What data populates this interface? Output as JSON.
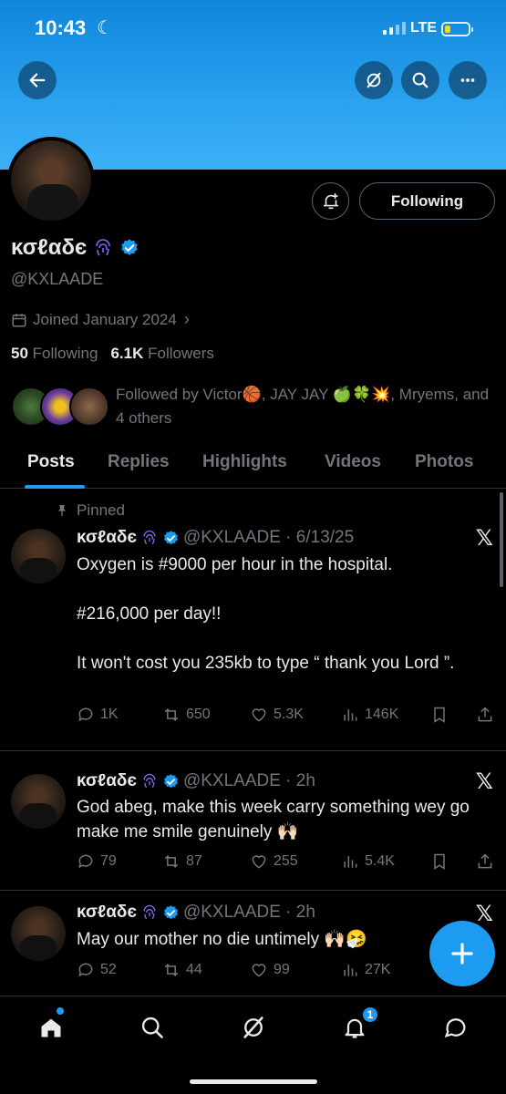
{
  "status_bar": {
    "time": "10:43",
    "network": "LTE",
    "colors": {
      "battery": "#ffd60a"
    }
  },
  "header": {
    "back_icon": "arrow-left-icon",
    "grok_icon": "grok-icon",
    "search_icon": "search-icon",
    "more_icon": "more-icon"
  },
  "profile": {
    "name": "κσℓαδє",
    "handle": "@KXLAADE",
    "joined": "Joined January 2024",
    "following_count": "50",
    "following_label": "Following",
    "followers_count": "6.1K",
    "followers_label": "Followers",
    "follow_button": "Following",
    "followed_by": "Followed by Victor🏀, JAY JAY 🍏🍀💥, Mryems, and 4 others"
  },
  "tabs": [
    {
      "label": "Posts",
      "active": true
    },
    {
      "label": "Replies"
    },
    {
      "label": "Highlights"
    },
    {
      "label": "Videos"
    },
    {
      "label": "Photos"
    }
  ],
  "tweets": [
    {
      "pinned_label": "Pinned",
      "name": "κσℓαδє",
      "meta": "@KXLAADE · 6/13/25",
      "text": "Oxygen is #9000 per hour in the hospital.\n\n#216,000 per day!!\n\nIt won't cost you 235kb to type “ thank you Lord ”.",
      "replies": "1K",
      "reposts": "650",
      "likes": "5.3K",
      "views": "146K"
    },
    {
      "name": "κσℓαδє",
      "meta": "@KXLAADE · 2h",
      "text": "God abeg, make this week carry something wey go make me smile genuinely 🙌🏻",
      "replies": "79",
      "reposts": "87",
      "likes": "255",
      "views": "5.4K"
    },
    {
      "name": "κσℓαδє",
      "meta": "@KXLAADE · 2h",
      "text": "May our mother no die untimely 🙌🏻🤧",
      "replies": "52",
      "reposts": "44",
      "likes": "99",
      "views": "27K"
    }
  ],
  "bottom_nav": {
    "notifications_badge": "1"
  },
  "colors": {
    "accent": "#1d9bf0",
    "background": "#000000",
    "muted": "#71767b",
    "text": "#e7e9ea"
  }
}
